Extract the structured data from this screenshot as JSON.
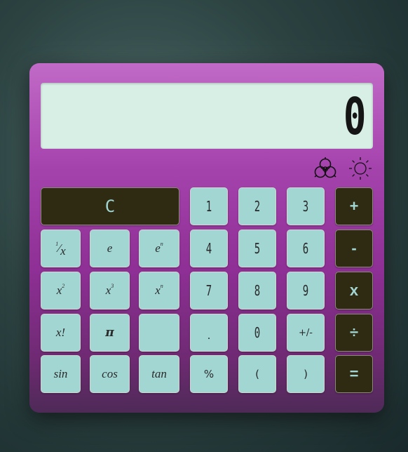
{
  "display": {
    "value": "0"
  },
  "icons": [
    {
      "name": "biohazard-icon"
    },
    {
      "name": "sun-icon"
    }
  ],
  "keys": {
    "clear": "C",
    "one": "1",
    "two": "2",
    "three": "3",
    "four": "4",
    "five": "5",
    "six": "6",
    "seven": "7",
    "eight": "8",
    "nine": "9",
    "zero": "0",
    "dot": ".",
    "plusminus": "+/-",
    "plus": "+",
    "minus": "-",
    "multiply": "x",
    "divide": "÷",
    "equals": "=",
    "reciprocal_num": "1",
    "reciprocal_den": "x",
    "e": "e",
    "e_pow_base": "e",
    "e_pow_exp": "n",
    "x_sq_base": "x",
    "x_sq_exp": "2",
    "x_cube_base": "x",
    "x_cube_exp": "3",
    "x_pow_base": "x",
    "x_pow_exp": "n",
    "factorial": "x!",
    "pi": "π",
    "blank": "",
    "sin": "sin",
    "cos": "cos",
    "tan": "tan",
    "percent": "%",
    "open_paren": "(",
    "close_paren": ")"
  }
}
